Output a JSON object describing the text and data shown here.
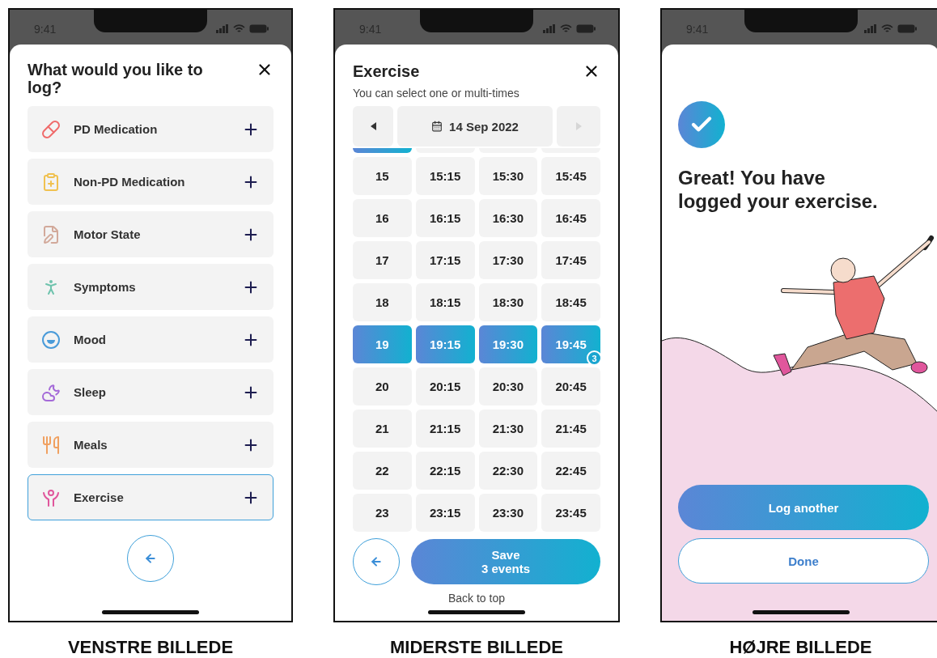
{
  "screens": [
    {
      "kind": "log_menu",
      "status_time": "9:41",
      "title": "What would you like to log?",
      "items": [
        {
          "label": "PD Medication",
          "selected": false
        },
        {
          "label": "Non-PD Medication",
          "selected": false
        },
        {
          "label": "Motor State",
          "selected": false
        },
        {
          "label": "Symptoms",
          "selected": false
        },
        {
          "label": "Mood",
          "selected": false
        },
        {
          "label": "Sleep",
          "selected": false
        },
        {
          "label": "Meals",
          "selected": false
        },
        {
          "label": "Exercise",
          "selected": true
        }
      ],
      "caption": "VENSTRE BILLEDE"
    },
    {
      "kind": "time_picker",
      "status_time": "9:41",
      "title": "Exercise",
      "subtitle": "You can select one or multi-times",
      "date": "14 Sep 2022",
      "prev_disabled": false,
      "next_disabled": true,
      "clipped_row": [
        {
          "selected": true
        },
        {
          "selected": false
        },
        {
          "selected": false
        },
        {
          "selected": false
        }
      ],
      "rows": [
        [
          {
            "label": "15",
            "selected": false
          },
          {
            "label": "15:15",
            "selected": false
          },
          {
            "label": "15:30",
            "selected": false
          },
          {
            "label": "15:45",
            "selected": false
          }
        ],
        [
          {
            "label": "16",
            "selected": false
          },
          {
            "label": "16:15",
            "selected": false
          },
          {
            "label": "16:30",
            "selected": false
          },
          {
            "label": "16:45",
            "selected": false
          }
        ],
        [
          {
            "label": "17",
            "selected": false
          },
          {
            "label": "17:15",
            "selected": false
          },
          {
            "label": "17:30",
            "selected": false
          },
          {
            "label": "17:45",
            "selected": false
          }
        ],
        [
          {
            "label": "18",
            "selected": false
          },
          {
            "label": "18:15",
            "selected": false
          },
          {
            "label": "18:30",
            "selected": false
          },
          {
            "label": "18:45",
            "selected": false
          }
        ],
        [
          {
            "label": "19",
            "selected": true
          },
          {
            "label": "19:15",
            "selected": true
          },
          {
            "label": "19:30",
            "selected": true
          },
          {
            "label": "19:45",
            "selected": true,
            "badge": "3"
          }
        ],
        [
          {
            "label": "20",
            "selected": false
          },
          {
            "label": "20:15",
            "selected": false
          },
          {
            "label": "20:30",
            "selected": false
          },
          {
            "label": "20:45",
            "selected": false
          }
        ],
        [
          {
            "label": "21",
            "selected": false
          },
          {
            "label": "21:15",
            "selected": false
          },
          {
            "label": "21:30",
            "selected": false
          },
          {
            "label": "21:45",
            "selected": false
          }
        ],
        [
          {
            "label": "22",
            "selected": false
          },
          {
            "label": "22:15",
            "selected": false
          },
          {
            "label": "22:30",
            "selected": false
          },
          {
            "label": "22:45",
            "selected": false
          }
        ],
        [
          {
            "label": "23",
            "selected": false
          },
          {
            "label": "23:15",
            "selected": false
          },
          {
            "label": "23:30",
            "selected": false
          },
          {
            "label": "23:45",
            "selected": false
          }
        ]
      ],
      "save_label": "Save",
      "save_sublabel": "3 events",
      "back_to_top": "Back to top",
      "caption": "MIDERSTE BILLEDE"
    },
    {
      "kind": "confirmation",
      "status_time": "9:41",
      "title": "Great! You have logged your exercise.",
      "buttons": [
        {
          "label": "Log another",
          "kind": "primary"
        },
        {
          "label": "Done",
          "kind": "secondary"
        }
      ],
      "caption": "HØJRE BILLEDE"
    }
  ]
}
